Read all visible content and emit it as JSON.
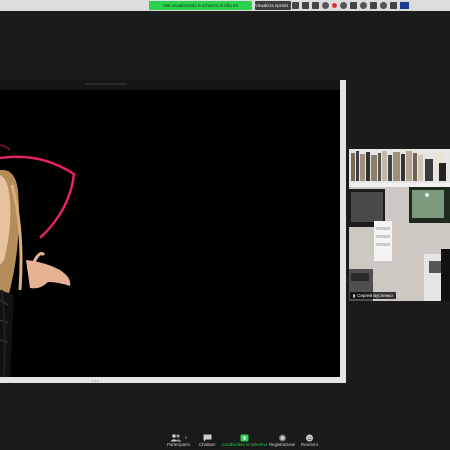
{
  "menubar": {
    "share_banner": "Stai visualizzando lo schermo di Villa Sri",
    "view_options": "Visualizza opzioni ⌄",
    "status_icons": [
      "dropbox-icon",
      "app-icon",
      "mail-icon",
      "person-icon",
      "record-icon",
      "cloud-icon",
      "wifi-icon",
      "audio-icon",
      "battery-icon",
      "search-icon",
      "control-center-icon",
      "zoom-app-icon"
    ]
  },
  "participant": {
    "name": "Сергей Бусленко"
  },
  "toolbar": {
    "participants": {
      "label": "Partecipanti",
      "count": "2"
    },
    "chat": {
      "label": "Chattare"
    },
    "share": {
      "label": "Condividere lo schermo"
    },
    "record": {
      "label": "Registrazione"
    },
    "reactions": {
      "label": "Reazioni"
    }
  },
  "colors": {
    "share_green": "#2bd14f",
    "toolbar_bg": "#1a1a1a",
    "hat_brim": "#e2245f"
  }
}
